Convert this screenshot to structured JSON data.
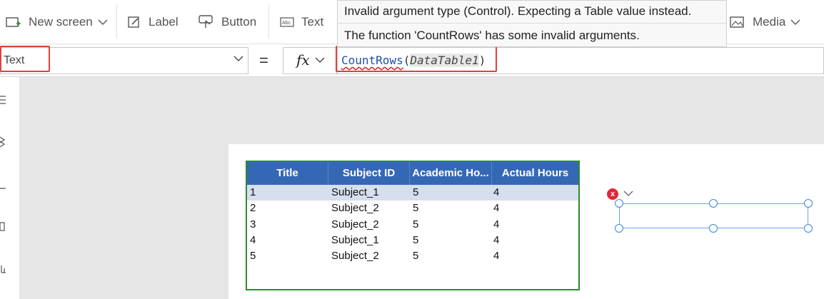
{
  "ribbon": {
    "new_screen": "New screen",
    "label": "Label",
    "button": "Button",
    "text": "Text",
    "media": "Media"
  },
  "tooltip": {
    "line1": "Invalid argument type (Control). Expecting a Table value instead.",
    "line2": "The function 'CountRows' has some invalid arguments."
  },
  "formula_bar": {
    "property": "Text",
    "equals": "=",
    "fx": "fx",
    "formula_function": "CountRows",
    "formula_open": "(",
    "formula_argument": "DataTable1",
    "formula_close": ")"
  },
  "data_table": {
    "columns": [
      "Title",
      "Subject ID",
      "Academic Ho...",
      "Actual Hours"
    ],
    "rows": [
      [
        "1",
        "Subject_1",
        "5",
        "4"
      ],
      [
        "2",
        "Subject_2",
        "5",
        "4"
      ],
      [
        "3",
        "Subject_2",
        "5",
        "4"
      ],
      [
        "4",
        "Subject_1",
        "5",
        "4"
      ],
      [
        "5",
        "Subject_2",
        "5",
        "4"
      ]
    ],
    "selected_row": 0
  },
  "label_control": {
    "error_glyph": "x"
  },
  "colors": {
    "accent": "#742774",
    "table_header": "#3568b4",
    "selection": "#d6dff0",
    "error": "#e32636",
    "highlight_box": "#e04040"
  }
}
